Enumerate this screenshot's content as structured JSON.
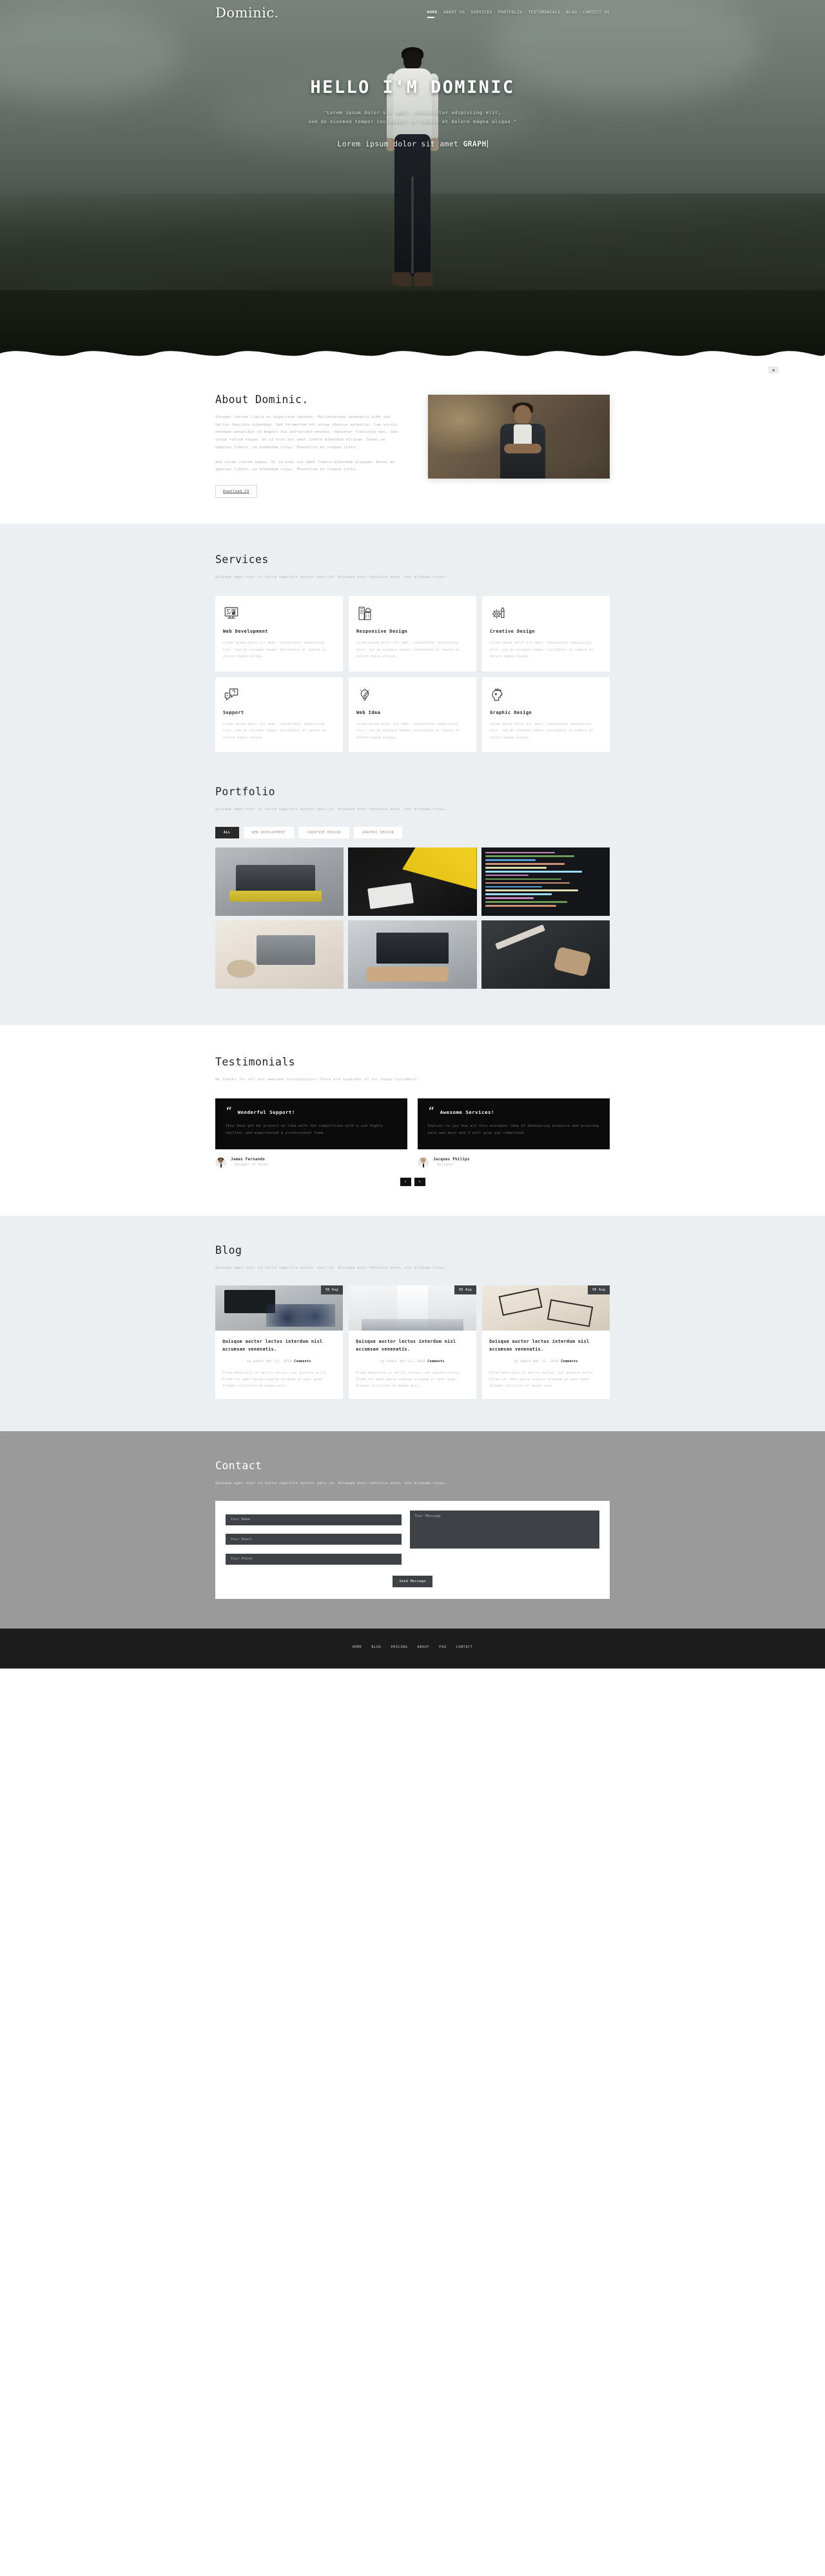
{
  "brand": {
    "name": "Dominic",
    "dot": "."
  },
  "nav": {
    "items": [
      {
        "label": "HOME",
        "active": true
      },
      {
        "label": "ABOUT US",
        "active": false
      },
      {
        "label": "SERVICES",
        "active": false
      },
      {
        "label": "PORTFOLIO",
        "active": false
      },
      {
        "label": "TESTIMONIALS",
        "active": false
      },
      {
        "label": "BLOG",
        "active": false
      },
      {
        "label": "CONTECT US",
        "active": false
      }
    ]
  },
  "hero": {
    "title": "HELLO I'M DOMINIC",
    "subtitle_line1": "\"Lorem ipsum dolor sit amet, consectetur adipiscing elit,",
    "subtitle_line2": "sed do eiusmod tempor incididunt ut labore et dolore magna aliqua.\"",
    "typed_prefix": "Lorem ipsum dolor sit amet ",
    "typed_word": "GRAPH"
  },
  "about": {
    "title": "About Dominic.",
    "paragraph1": "Integer rutrum ligula eu dignissim laoreet. Pellentesque venenatis nibh sed tellus faucibus bibendum. Sed fermentum est vitae rhoncus molestie. Cum sociis natoque penatibus et magnis dis parturient montes, nascetur ridiculus mus. Sed vitae rutrum neque. Ut id erat sit amet libero bibendum aliquam. Donec ac egestas libero, eu bibendum risus. Phasellus et congue justo.",
    "paragraph2": "Sed vitae rutrum neque. Ut id erat sit amet libero bibendum aliquam. Donec ac egestas libero, eu bibendum risus. Phasellus et congue justo.",
    "button": "Download CV",
    "scroll_top": "▲"
  },
  "services": {
    "title": "Services",
    "description": "Quisque eget nisl id nulla sagittis auctor quis id. Aliquam quis vehicula enim, non aliquam risus.",
    "items": [
      {
        "icon": "monitor-chart-icon",
        "title": "Web Development",
        "text": "Lorem ipsum dolor sit amet, consectetur adipiscing elit, sed do eiusmod tempor incididunt ut labore et dolore magna aliqua."
      },
      {
        "icon": "buildings-cloud-icon",
        "title": "Responsive Design",
        "text": "Lorem ipsum dolor sit amet, consectetur adipiscing elit, sed do eiusmod tempor incididunt ut labore et dolore magna aliqua."
      },
      {
        "icon": "gear-pen-icon",
        "title": "Creative Design",
        "text": "Lorem ipsum dolor sit amet, consectetur adipiscing elit, sed do eiusmod tempor incididunt ut labore et dolore magna aliqua."
      },
      {
        "icon": "chat-question-icon",
        "title": "Support",
        "text": "Lorem ipsum dolor sit amet, consectetur adipiscing elit, sed do eiusmod tempor incididunt ut labore et dolore magna aliqua."
      },
      {
        "icon": "lightbulb-pencil-icon",
        "title": "Web Idea",
        "text": "Lorem ipsum dolor sit amet, consectetur adipiscing elit, sed do eiusmod tempor incididunt ut labore et dolore magna aliqua."
      },
      {
        "icon": "head-pencils-icon",
        "title": "Graphic Design",
        "text": "Lorem ipsum dolor sit amet, consectetur adipiscing elit, sed do eiusmod tempor incididunt ut labore et dolore magna aliqua."
      }
    ]
  },
  "portfolio": {
    "title": "Portfolio",
    "description": "Quisque eget nisl id nulla sagittis auctor quis id. Aliquam quis vehicula enim, non aliquam risus.",
    "filters": [
      {
        "label": "ALL",
        "active": true
      },
      {
        "label": "WEB DEVELOPMENT",
        "active": false
      },
      {
        "label": "CREATIVE DESIGN",
        "active": false
      },
      {
        "label": "GRAPHIC DESIGN",
        "active": false
      }
    ],
    "items": [
      {
        "name": "laptop-yellow-desk"
      },
      {
        "name": "yellow-geometric-notebook"
      },
      {
        "name": "code-editor-screen"
      },
      {
        "name": "desk-flatlay-coffee"
      },
      {
        "name": "hands-on-laptop"
      },
      {
        "name": "pencil-sketch-dark"
      }
    ]
  },
  "testimonials": {
    "title": "Testimonials",
    "description": "We thanks for all our awesome testimonials! There are hundreds of our happy customers!",
    "items": [
      {
        "quote_icon": "“",
        "title": "Wonderful Support!",
        "text": "They have got my project on time with the competition with a sed highly skilled, and experienced & professional team.",
        "author": "James Fernando",
        "role": "- Manager of Racer"
      },
      {
        "quote_icon": "“",
        "title": "Awesome Services!",
        "text": "Explain to you how all this mistaken idea of denouncing pleasure and praising pain was born and I will give you completed.",
        "author": "Jacques Philips",
        "role": "- Designer"
      }
    ],
    "prev_label": "‹",
    "next_label": "›"
  },
  "blog": {
    "title": "Blog",
    "description": "Quisque eget nisl id nulla sagittis auctor quis id. Aliquam quis vehicula enim, non aliquam risus.",
    "posts": [
      {
        "date": "06 Aug",
        "title": "Quisque auctor lectus interdum nisl accumsan venenatis.",
        "meta_author": "by admin Apr 21, 2018 ",
        "meta_comments": "Comments",
        "excerpt": "Etiam materials ut mollis tellus, vel posuere nulla. Etiam sit amet massa sodales aliquam at eget quam. Integer ultricies et magna quis.",
        "image": "bike-workshop"
      },
      {
        "date": "06 Aug",
        "title": "Quisque auctor lectus interdum nisl accumsan venenatis.",
        "meta_author": "by admin Apr 21, 2018 ",
        "meta_comments": "Comments",
        "excerpt": "Etiam materials ut mollis tellus, vel posuere nulla. Etiam sit amet massa sodales aliquam at eget quam. Integer ultricies et magna quis.",
        "image": "white-corridor"
      },
      {
        "date": "06 Aug",
        "title": "Quisque auctor lectus interdum nisl accumsan venenatis.",
        "meta_author": "by admin Apr 21, 2018 ",
        "meta_comments": "Comments",
        "excerpt": "Etiam materials ut mollis tellus, vel posuere nulla. Etiam sit amet massa sodales aliquam at eget quam. Integer ultricies et magna quis.",
        "image": "chairs-sketch"
      }
    ]
  },
  "contact": {
    "title": "Contact",
    "description": "Quisque eget nisl id nulla sagittis auctor quis id. Aliquam quis vehicula enim, non aliquam risus.",
    "name_placeholder": "Your Name",
    "email_placeholder": "Your Email",
    "phone_placeholder": "Your Phone",
    "message_placeholder": "Your Message",
    "submit_label": "Send Message"
  },
  "footer": {
    "links": [
      {
        "label": "HOME"
      },
      {
        "label": "BLOG"
      },
      {
        "label": "PRICING"
      },
      {
        "label": "ABOUT"
      },
      {
        "label": "FAQ"
      },
      {
        "label": "CONTACT"
      }
    ]
  },
  "colors": {
    "accent_dark": "#2a2a2a",
    "section_bg": "#eceff1",
    "card_dark": "#0b0b0b",
    "field_bg": "#3e4145",
    "footer_bg": "#1c1c1c"
  }
}
